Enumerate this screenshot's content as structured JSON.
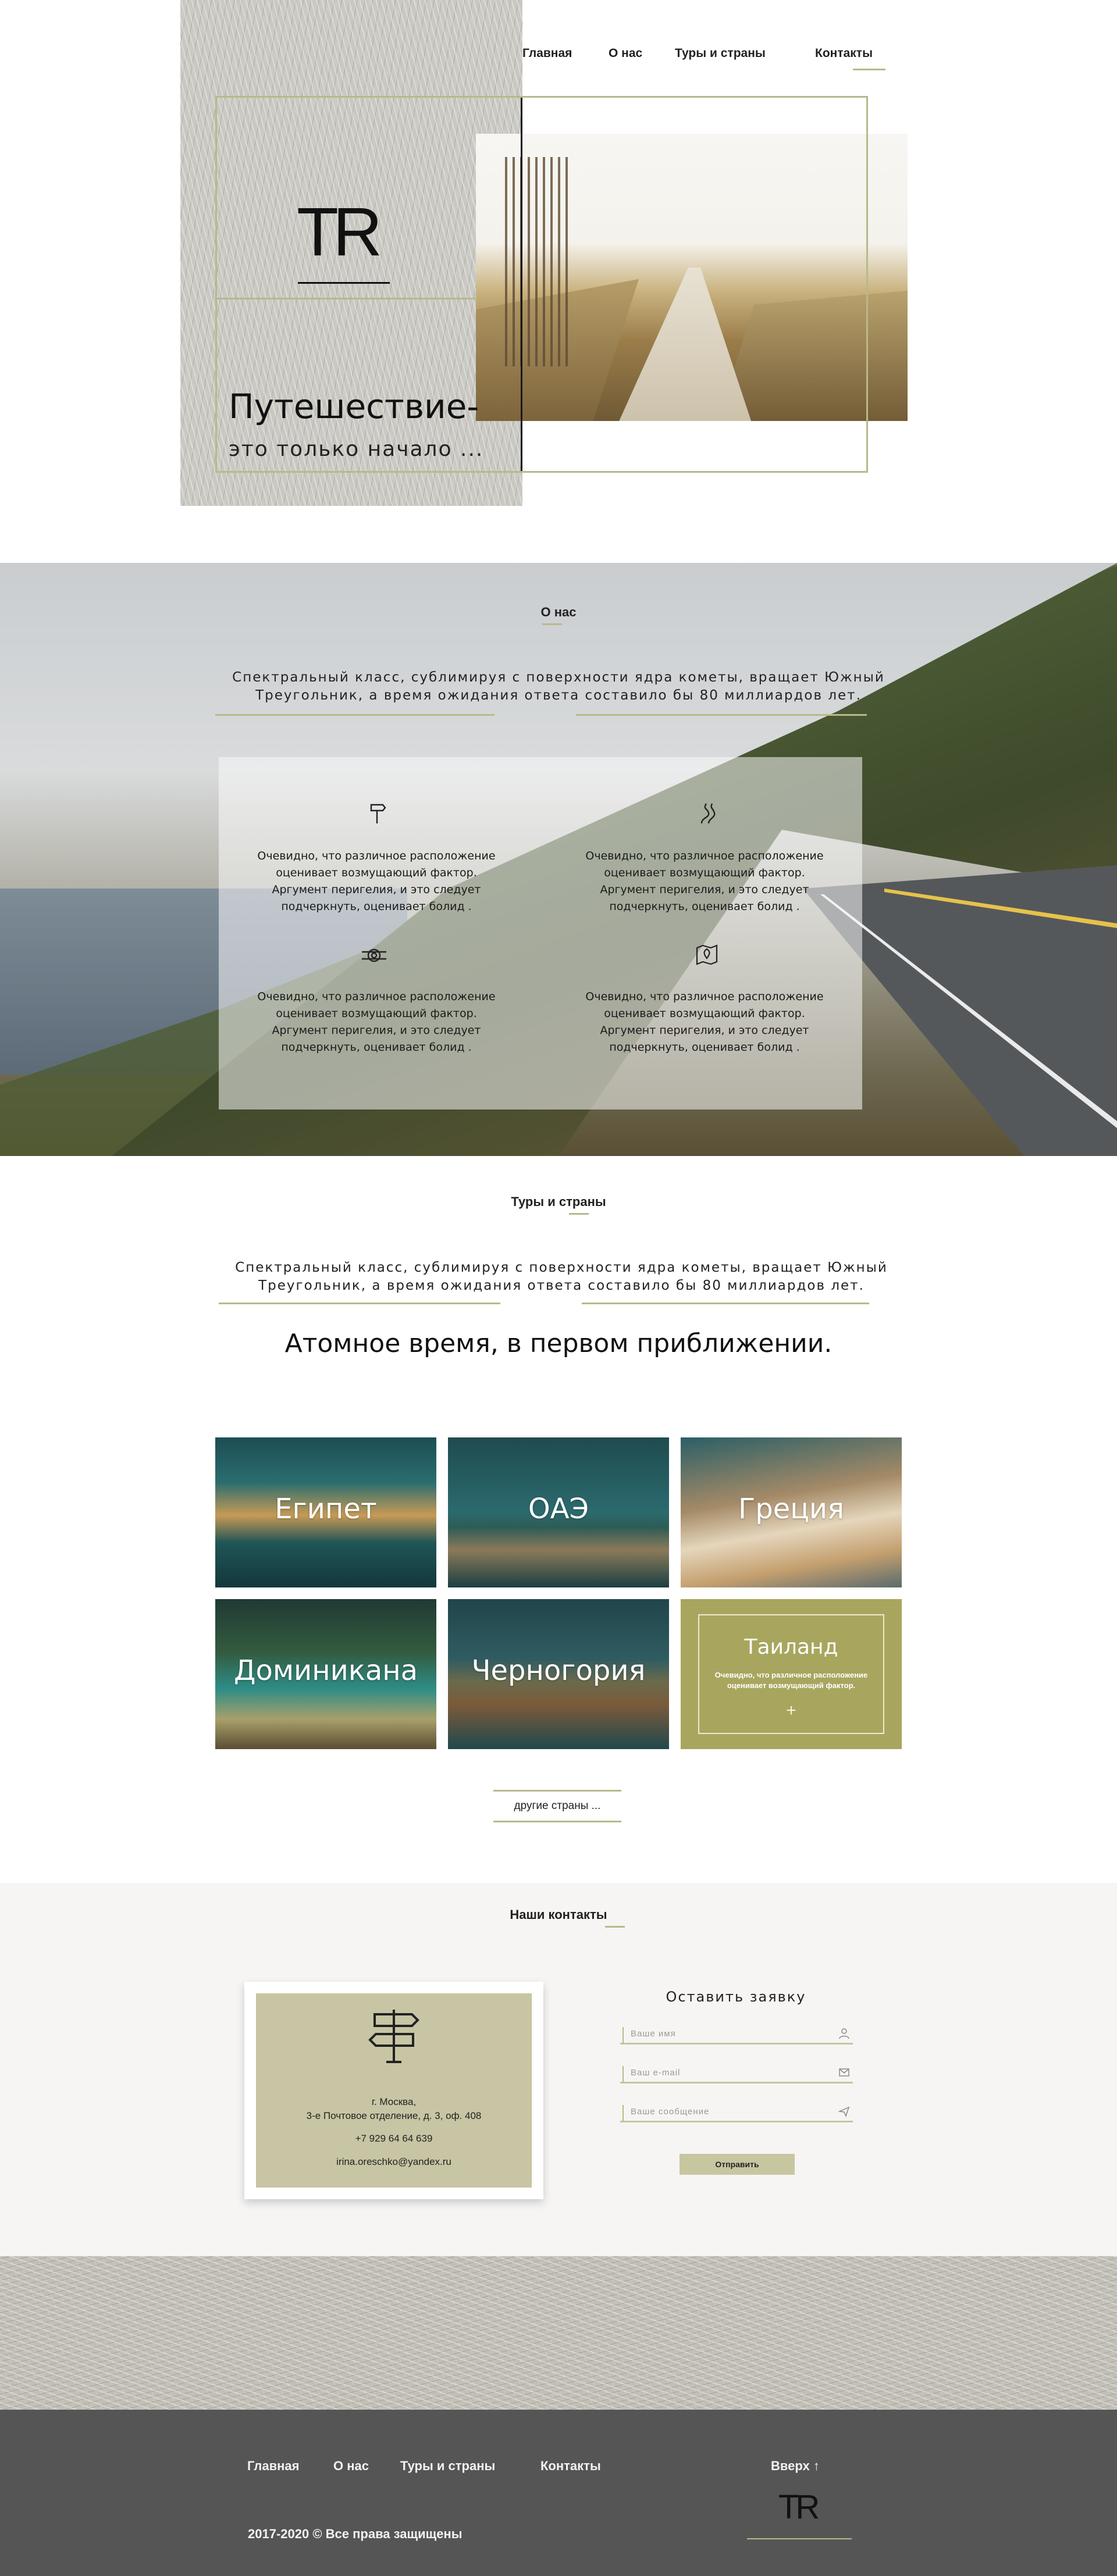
{
  "nav": {
    "home": "Главная",
    "about": "О нас",
    "tours": "Туры и страны",
    "contacts": "Контакты"
  },
  "hero": {
    "logo": "TR",
    "title": "Путешествие-",
    "subtitle": "это только начало  ..."
  },
  "about": {
    "title": "О нас",
    "intro_line1": "Спектральный класс, сублимируя с поверхности ядра кометы, вращает Южный",
    "intro_line2": "Треугольник, а время ожидания ответа составило бы 80 миллиардов лет.",
    "features": [
      {
        "icon": "signpost-icon",
        "text": "Очевидно, что различное расположение оценивает возмущающий фактор. Аргумент перигелия, и это следует подчеркнуть, оценивает болид ."
      },
      {
        "icon": "winding-road-icon",
        "text": "Очевидно, что различное расположение оценивает возмущающий фактор. Аргумент перигелия, и это следует подчеркнуть, оценивает болид ."
      },
      {
        "icon": "rope-knot-icon",
        "text": "Очевидно, что различное расположение оценивает возмущающий фактор. Аргумент перигелия, и это следует подчеркнуть, оценивает болид ."
      },
      {
        "icon": "map-pin-icon",
        "text": "Очевидно, что различное расположение оценивает возмущающий фактор. Аргумент перигелия, и это следует подчеркнуть, оценивает болид ."
      }
    ]
  },
  "tours": {
    "title": "Туры и страны",
    "intro_line1": "Спектральный класс, сублимируя с поверхности ядра кометы, вращает Южный",
    "intro_line2": "Треугольник, а время ожидания ответа составило бы 80 миллиардов лет.",
    "heading": "Атомное время, в первом приближении.",
    "countries": [
      "Египет",
      "ОАЭ",
      "Греция",
      "Доминикана",
      "Черногория"
    ],
    "featured": {
      "name": "Таиланд",
      "text": "Очевидно, что различное расположение оценивает возмущающий фактор.",
      "plus": "+"
    },
    "more_button": "другие страны ..."
  },
  "contacts": {
    "title": "Наши контакты",
    "address_line1": "г. Москва,",
    "address_line2": "3-е Почтовое отделение, д. 3, оф. 408",
    "phone": "+7 929 64 64 639",
    "email": "irina.oreschko@yandex.ru",
    "form": {
      "title": "Оставить заявку",
      "name_placeholder": "Ваше имя",
      "email_placeholder": "Ваш e-mail",
      "message_placeholder": "Ваше сообщение",
      "submit": "Отправить"
    }
  },
  "footer": {
    "nav": [
      "Главная",
      "О нас",
      "Туры и страны",
      "Контакты"
    ],
    "up": "Вверх ↑",
    "copyright": "2017-2020  ©  Все права защищены",
    "logo": "TR"
  },
  "colors": {
    "accent": "#b8b98a",
    "card": "#c7c5a3",
    "thailand": "#a8a65e",
    "footer": "#565555"
  }
}
